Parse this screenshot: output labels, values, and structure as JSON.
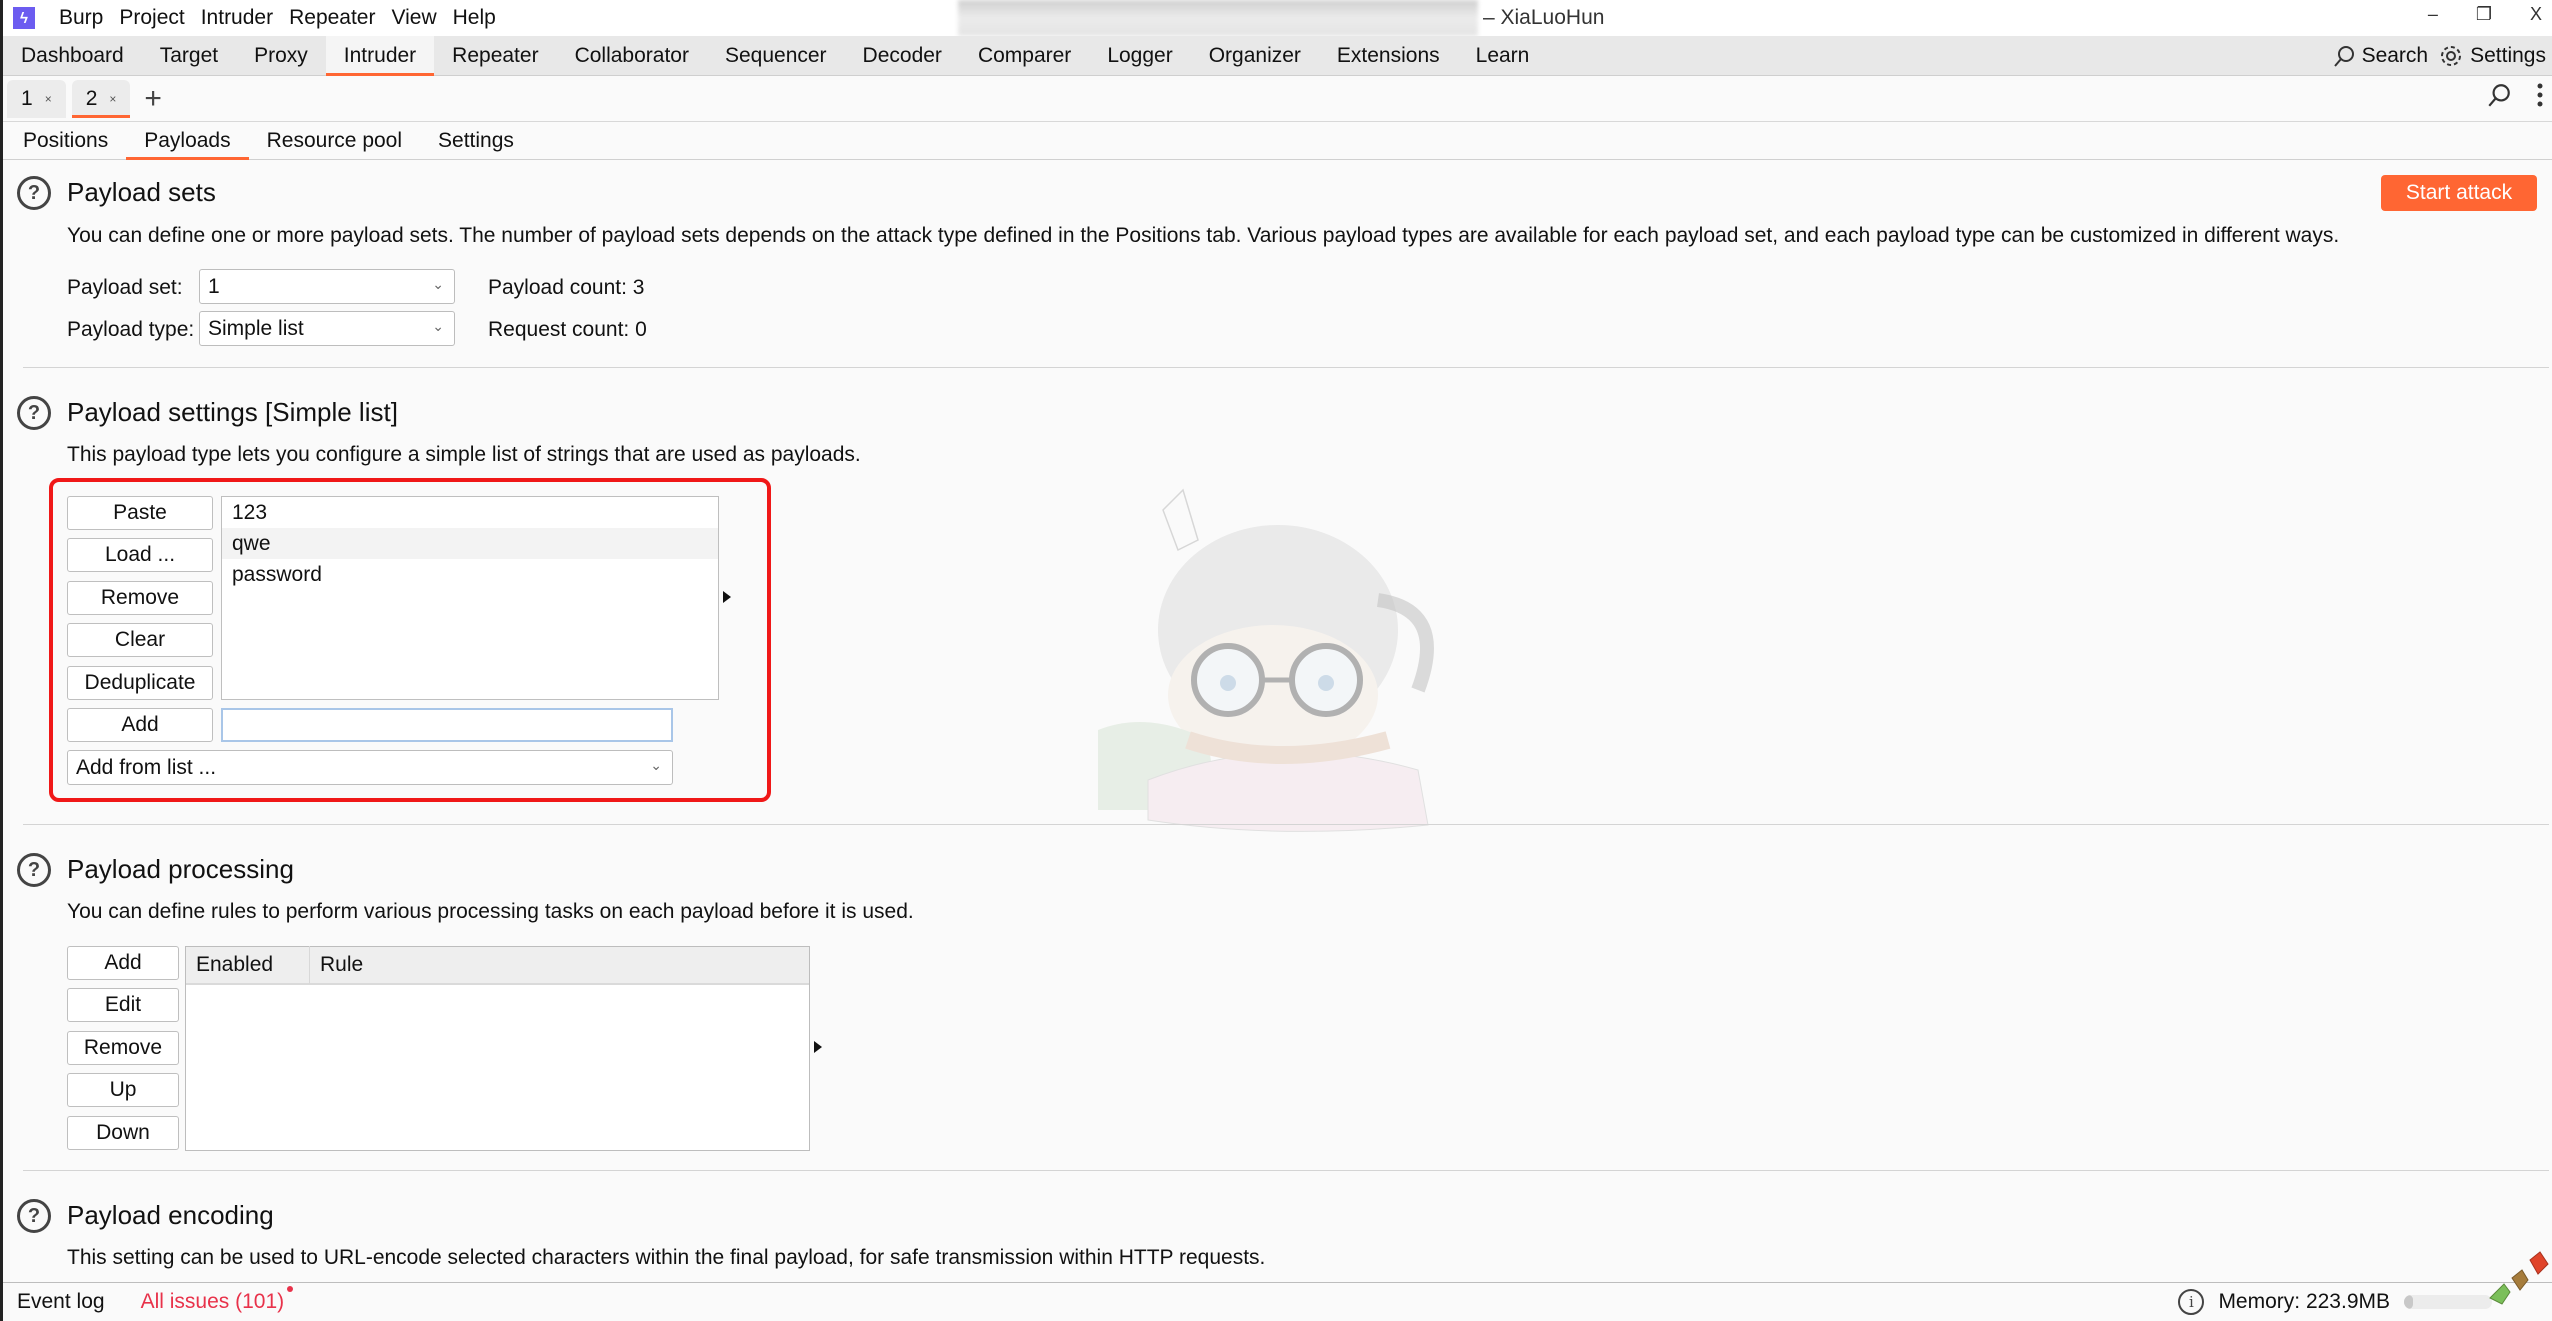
{
  "app": {
    "logo_glyph": "ϟ",
    "window_title": "– XiaLuoHun",
    "menu": [
      "Burp",
      "Project",
      "Intruder",
      "Repeater",
      "View",
      "Help"
    ],
    "window_controls": {
      "minimize": "–",
      "restore": "❐",
      "close": "X"
    }
  },
  "main_tabs": {
    "items": [
      "Dashboard",
      "Target",
      "Proxy",
      "Intruder",
      "Repeater",
      "Collaborator",
      "Sequencer",
      "Decoder",
      "Comparer",
      "Logger",
      "Organizer",
      "Extensions",
      "Learn"
    ],
    "active": "Intruder",
    "search_label": "Search",
    "settings_label": "Settings"
  },
  "instance_tabs": {
    "items": [
      {
        "label": "1",
        "close": "×"
      },
      {
        "label": "2",
        "close": "×"
      }
    ],
    "active": "2",
    "add_glyph": "+"
  },
  "sub_tabs": {
    "items": [
      "Positions",
      "Payloads",
      "Resource pool",
      "Settings"
    ],
    "active": "Payloads"
  },
  "payload_sets": {
    "title": "Payload sets",
    "description": "You can define one or more payload sets. The number of payload sets depends on the attack type defined in the Positions tab. Various payload types are available for each payload set, and each payload type can be customized in different ways.",
    "start_attack_label": "Start attack",
    "payload_set_label": "Payload set:",
    "payload_set_value": "1",
    "payload_type_label": "Payload type:",
    "payload_type_value": "Simple list",
    "payload_count": "Payload count: 3",
    "request_count": "Request count: 0"
  },
  "payload_settings": {
    "title": "Payload settings [Simple list]",
    "description": "This payload type lets you configure a simple list of strings that are used as payloads.",
    "buttons": [
      "Paste",
      "Load ...",
      "Remove",
      "Clear",
      "Deduplicate"
    ],
    "items": [
      "123",
      "qwe",
      "password"
    ],
    "add_label": "Add",
    "add_input_value": "",
    "add_from_list_label": "Add from list ..."
  },
  "payload_processing": {
    "title": "Payload processing",
    "description": "You can define rules to perform various processing tasks on each payload before it is used.",
    "buttons": [
      "Add",
      "Edit",
      "Remove",
      "Up",
      "Down"
    ],
    "columns": [
      "Enabled",
      "Rule"
    ],
    "rows": []
  },
  "payload_encoding": {
    "title": "Payload encoding",
    "description": "This setting can be used to URL-encode selected characters within the final payload, for safe transmission within HTTP requests."
  },
  "status_bar": {
    "event_log": "Event log",
    "all_issues": "All issues (101)",
    "memory": "Memory: 223.9MB",
    "memory_usage_fraction": 0.1
  },
  "help_glyph": "?",
  "info_glyph": "i",
  "colors": {
    "accent": "#ff6633",
    "highlight_box": "#f01818",
    "issues": "#e8324a",
    "logo": "#6c5cf0"
  }
}
